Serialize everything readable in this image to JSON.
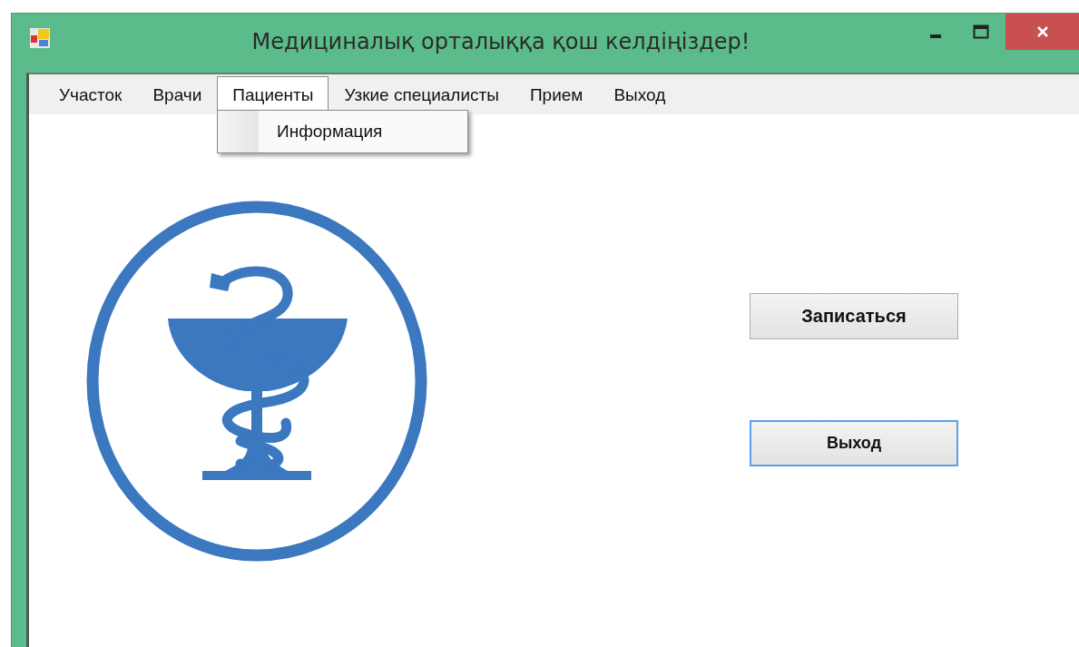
{
  "window": {
    "title": "Медициналық орталыққа қош келдіңіздер!"
  },
  "menu": [
    {
      "label": "Участок",
      "selected": false
    },
    {
      "label": "Врачи",
      "selected": false
    },
    {
      "label": "Пациенты",
      "selected": true,
      "items": [
        "Информация"
      ]
    },
    {
      "label": "Узкие специалисты",
      "selected": false
    },
    {
      "label": "Прием",
      "selected": false
    },
    {
      "label": "Выход",
      "selected": false
    }
  ],
  "buttons": [
    {
      "label": "Записаться",
      "focused": false
    },
    {
      "label": "Выход",
      "focused": true
    }
  ]
}
